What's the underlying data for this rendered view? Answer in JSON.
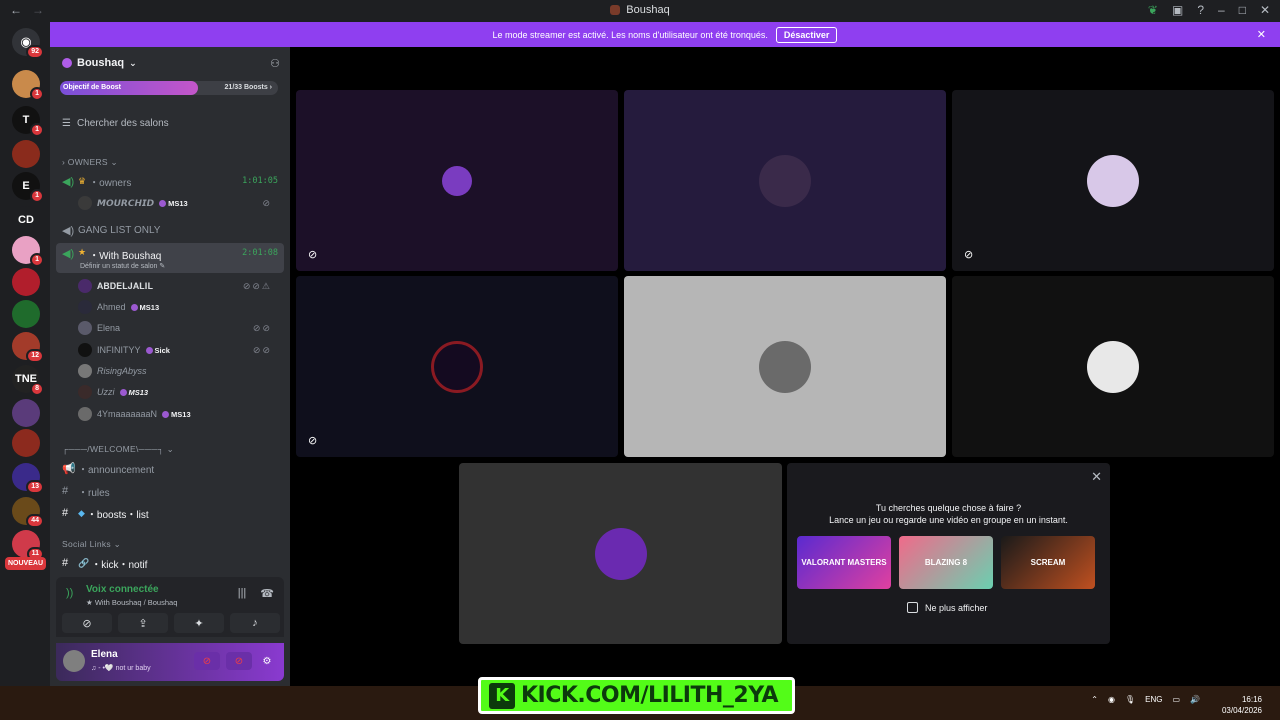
{
  "window": {
    "title": "Boushaq"
  },
  "rail": {
    "home_badge": "92",
    "servers": [
      {
        "label": "",
        "badge": "1",
        "color": "#c98a4b"
      },
      {
        "label": "T",
        "badge": "1",
        "color": "#111111"
      },
      {
        "label": "",
        "badge": "",
        "color": "#8a2b1c"
      },
      {
        "label": "E",
        "badge": "1",
        "color": "#111111"
      },
      {
        "label": "CD",
        "badge": "",
        "color": "#1e1f22"
      },
      {
        "label": "",
        "badge": "1",
        "color": "#e9a1c4"
      },
      {
        "label": "",
        "badge": "",
        "color": "#b11e2c"
      },
      {
        "label": "",
        "badge": "",
        "color": "#1f6b2c"
      },
      {
        "label": "",
        "badge": "12",
        "color": "#a33b2a"
      },
      {
        "label": "TNE",
        "badge": "8",
        "color": "#222222"
      },
      {
        "label": "",
        "badge": "",
        "color": "#5a3b7a"
      },
      {
        "label": "",
        "badge": "",
        "color": "#8c2a1e"
      },
      {
        "label": "",
        "badge": "13",
        "color": "#3a2a8a"
      },
      {
        "label": "",
        "badge": "44",
        "color": "#6a4a1a"
      },
      {
        "label": "",
        "badge": "11",
        "color": "#d03a4a"
      }
    ],
    "new_label": "NOUVEAU"
  },
  "banner": {
    "message": "Le mode streamer est activé. Les noms d'utilisateur ont été tronqués.",
    "button": "Désactiver"
  },
  "sidebar": {
    "guild_name": "Boushaq",
    "boost_label": "Objectif de Boost",
    "boost_count": "21/33 Boosts",
    "search": "Chercher des salons",
    "categories": {
      "owners": "OWNERS",
      "welcome": "┌───/WELCOME\\───┐",
      "social": "Social Links"
    },
    "channels": {
      "owners": {
        "name": "owners",
        "timer": "1:01:05"
      },
      "gang": {
        "name": "GANG LIST ONLY"
      },
      "with_boushaq": {
        "name": "With Boushaq",
        "timer": "2:01:08",
        "sub": "Définir un statut de salon"
      },
      "announcement": {
        "name": "announcement"
      },
      "rules": {
        "name": "rules"
      },
      "boosts": {
        "name": "boosts・list"
      },
      "kick": {
        "name": "kick・notif"
      }
    },
    "owners_users": [
      {
        "name": "𝙈𝙊𝙐𝙍𝘾𝙃𝙄𝘿",
        "tag": "MS13"
      }
    ],
    "voice_users": [
      {
        "name": "𝐀𝐁𝐃𝐄𝐋𝐉𝐀𝐋𝐈𝐋",
        "tag": ""
      },
      {
        "name": "Ahmed",
        "tag": "MS13"
      },
      {
        "name": "Elena",
        "tag": ""
      },
      {
        "name": "INFINITYY",
        "tag": "Sick"
      },
      {
        "name": "RisingAbyss",
        "tag": ""
      },
      {
        "name": "Uzzi",
        "tag": "MS13"
      },
      {
        "name": "4YmaaaaaaaN",
        "tag": "MS13"
      }
    ]
  },
  "voice": {
    "title": "Voix connectée",
    "subtitle": "With Boushaq / Boushaq"
  },
  "user": {
    "name": "Elena",
    "status": "♫ - •🤍 not ur baby"
  },
  "activity": {
    "line1": "Tu cherches quelque chose à faire ?",
    "line2": "Lance un jeu ou regarde une vidéo en groupe en un instant.",
    "cards": [
      "VALORANT MASTERS",
      "BLAZING 8",
      "SCREAM"
    ],
    "dont_show": "Ne plus afficher"
  },
  "overlay": {
    "kick_text": "KICK.COM/LILITH_2YA"
  },
  "taskbar": {
    "lang": "ENG",
    "time": "16:16",
    "date": "03/04/2026"
  }
}
